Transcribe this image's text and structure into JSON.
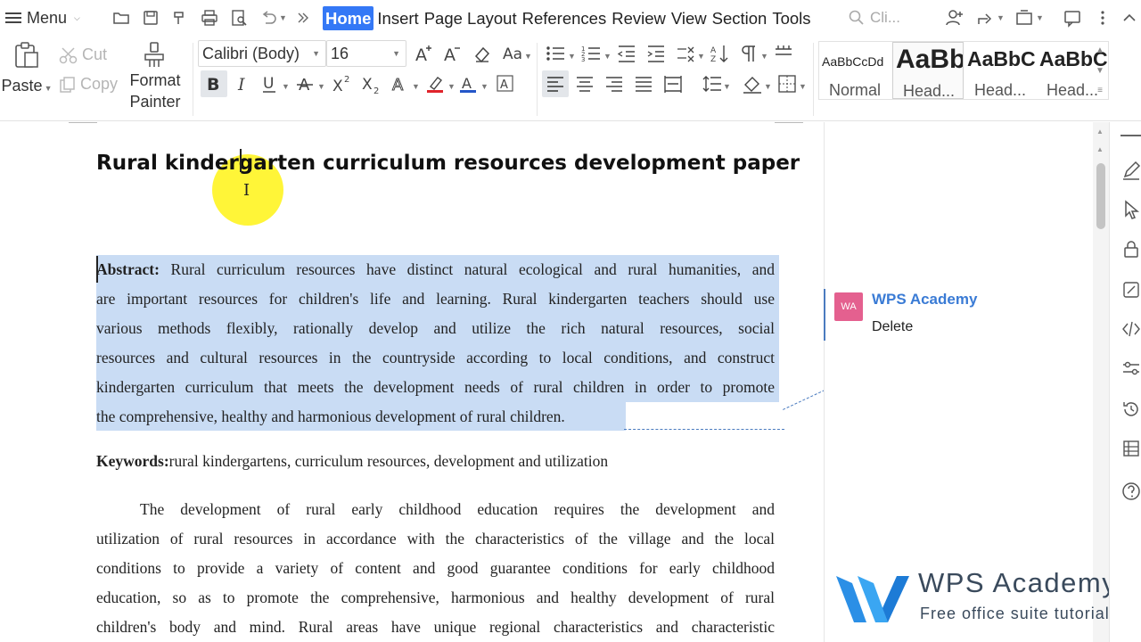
{
  "menu": {
    "label": "Menu"
  },
  "tabs": [
    "Home",
    "Insert",
    "Page Layout",
    "References",
    "Review",
    "View",
    "Section",
    "Tools"
  ],
  "search": {
    "placeholder": "Cli..."
  },
  "ribbon": {
    "paste": "Paste",
    "cut": "Cut",
    "copy": "Copy",
    "format_painter": [
      "Format",
      "Painter"
    ],
    "font_name": "Calibri (Body)",
    "font_size": "16",
    "styles": [
      {
        "sample": "AaBbCcDd",
        "name": "Normal"
      },
      {
        "sample": "AaBb",
        "name": "Head..."
      },
      {
        "sample": "AaBbCc",
        "name": "Head..."
      },
      {
        "sample": "AaBbCc",
        "name": "Head..."
      }
    ]
  },
  "document": {
    "title": "Rural kindergarten curriculum resources development paper",
    "abstract_label": "Abstract:",
    "abstract_lines": [
      "Rural curriculum resources have distinct natural ecological and rural humanities, and",
      "are important resources for children's life and learning. Rural kindergarten teachers should use",
      "various methods flexibly, rationally develop and utilize the rich natural resources, social",
      "resources and cultural resources in the countryside according to local conditions, and construct",
      "kindergarten curriculum that meets the development needs of rural children in order to promote",
      "the comprehensive, healthy and harmonious development of rural children."
    ],
    "keywords_label": "Keywords:",
    "keywords": "rural kindergartens, curriculum resources, development and utilization",
    "body_lines": [
      "The development of rural early childhood education requires the development and",
      "utilization of rural resources in accordance with the characteristics of the village and the local",
      "conditions to provide a variety of content and good guarantee conditions for early childhood",
      "education, so as to promote the comprehensive, harmonious and healthy development of rural",
      "children's body and mind. Rural areas have unique regional characteristics and characteristic"
    ]
  },
  "comment": {
    "avatar_text": "WA",
    "author": "WPS Academy",
    "text": "Delete"
  },
  "brand": {
    "name": "WPS Academy",
    "tagline": "Free office suite tutorials"
  },
  "colors": {
    "accent": "#3478f6",
    "selection": "#c9dcf4",
    "comment_author": "#3a7bd5",
    "avatar": "#e4608f",
    "highlight": "#fff200",
    "font_color_red": "#e0242b",
    "font_color_blue": "#2456c8"
  }
}
